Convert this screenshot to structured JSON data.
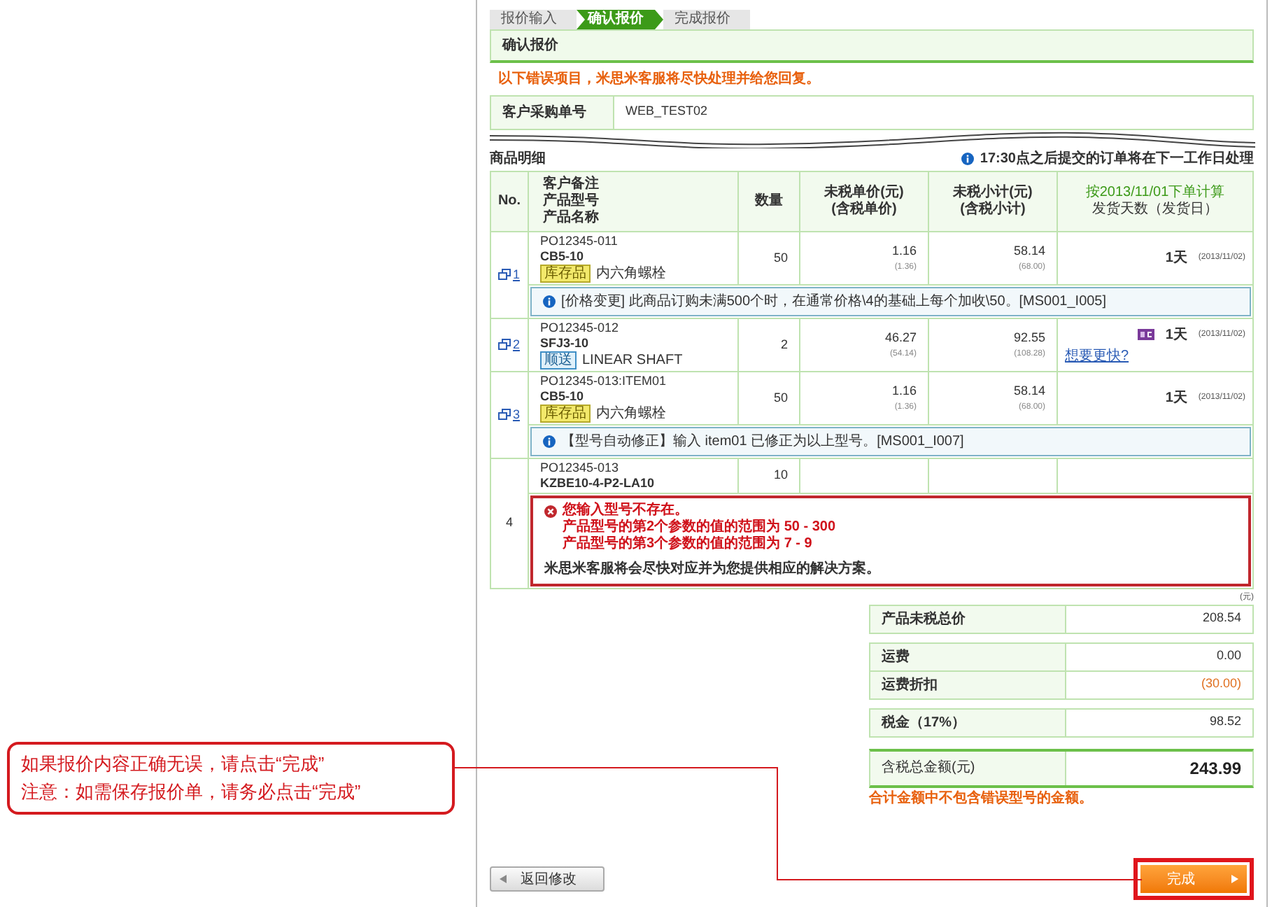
{
  "steps": [
    {
      "label": "报价输入",
      "selected": false
    },
    {
      "label": "确认报价",
      "selected": true
    },
    {
      "label": "完成报价",
      "selected": false
    }
  ],
  "title": "确认报价",
  "warning": "以下错误项目，米思米客服将尽快处理并给您回复。",
  "po": {
    "label": "客户采购单号",
    "value": "WEB_TEST02"
  },
  "items_heading": "商品明细",
  "notice": "17:30点之后提交的订单将在下一工作日处理",
  "table": {
    "columns": [
      {
        "lines": [
          "No."
        ]
      },
      {
        "lines": [
          "客户备注",
          "产品型号",
          "产品名称"
        ]
      },
      {
        "lines": [
          "数量"
        ]
      },
      {
        "lines": [
          "未税单价(元)",
          "(含税单价)"
        ]
      },
      {
        "lines": [
          "未税小计(元)",
          "(含税小计)"
        ]
      },
      {
        "lines": [
          "按2013/11/01下单计算",
          "发货天数（发货日）"
        ]
      }
    ],
    "rows": [
      {
        "no": "1",
        "linked": true,
        "po": "PO12345-011",
        "part": "CB5-10",
        "tag": {
          "kind": "stock",
          "label": "库存品"
        },
        "name": "内六角螺栓",
        "qty": "50",
        "unit_price": "1.16",
        "unit_price_tax": "(1.36)",
        "subtotal": "58.14",
        "subtotal_tax": "(68.00)",
        "days": "1天",
        "date": "(2013/11/02)",
        "fast_badge": false,
        "message": {
          "kind": "info",
          "text": "[价格变更] 此商品订购未满500个时，在通常价格\\4的基础上每个加收\\50。[MS001_I005]"
        }
      },
      {
        "no": "2",
        "linked": true,
        "po": "PO12345-012",
        "part": "SFJ3-10",
        "tag": {
          "kind": "express",
          "label": "顺送"
        },
        "name": "LINEAR SHAFT",
        "qty": "2",
        "unit_price": "46.27",
        "unit_price_tax": "(54.14)",
        "subtotal": "92.55",
        "subtotal_tax": "(108.28)",
        "days": "1天",
        "date": "(2013/11/02)",
        "fast_badge": true,
        "faster_link": "想要更快?"
      },
      {
        "no": "3",
        "linked": true,
        "po": "PO12345-013:ITEM01",
        "part": "CB5-10",
        "tag": {
          "kind": "stock",
          "label": "库存品"
        },
        "name": "内六角螺栓",
        "qty": "50",
        "unit_price": "1.16",
        "unit_price_tax": "(1.36)",
        "subtotal": "58.14",
        "subtotal_tax": "(68.00)",
        "days": "1天",
        "date": "(2013/11/02)",
        "fast_badge": false,
        "message": {
          "kind": "info",
          "text": "【型号自动修正】输入 item01 已修正为以上型号。[MS001_I007]"
        }
      },
      {
        "no": "4",
        "linked": false,
        "po": "PO12345-013",
        "part": "KZBE10-4-P2-LA10",
        "qty": "10",
        "message": {
          "kind": "error",
          "lines": [
            "您输入型号不存在。",
            "产品型号的第2个参数的值的范围为 50 - 300",
            "产品型号的第3个参数的值的范围为 7 - 9"
          ],
          "footer": "米思米客服将会尽快对应并为您提供相应的解决方案。"
        }
      }
    ]
  },
  "summary": {
    "unit": "(元)",
    "groups": [
      [
        {
          "kind": "normal",
          "label": "产品未税总价",
          "value": "208.54"
        }
      ],
      [
        {
          "kind": "normal",
          "label": "运费",
          "value": "0.00"
        },
        {
          "kind": "discount",
          "label": "运费折扣",
          "value": "(30.00)"
        }
      ],
      [
        {
          "kind": "normal",
          "label": "税金（17%）",
          "value": "98.52"
        }
      ],
      [
        {
          "kind": "total",
          "label": "含税总金额(元)",
          "value": "243.99"
        }
      ]
    ],
    "note": "合计金额中不包含错误型号的金额。"
  },
  "back_button": "返回修改",
  "finish_button": "完成",
  "callout": [
    "如果报价内容正确无误，请点击“完成”",
    "注意：如需保存报价单，请务必点击“完成”"
  ]
}
